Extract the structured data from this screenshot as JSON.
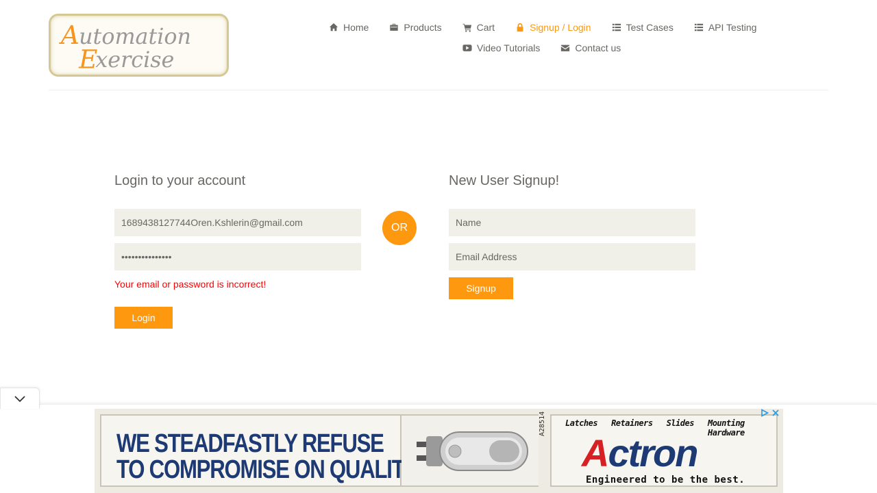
{
  "logo": {
    "line1": "Automation",
    "line2": "Exercise"
  },
  "nav": {
    "row1": [
      {
        "label": "Home",
        "icon": "home-icon"
      },
      {
        "label": "Products",
        "icon": "products-icon"
      },
      {
        "label": "Cart",
        "icon": "cart-icon"
      },
      {
        "label": "Signup / Login",
        "icon": "lock-icon",
        "active": true
      },
      {
        "label": "Test Cases",
        "icon": "list-icon"
      },
      {
        "label": "API Testing",
        "icon": "list-icon"
      }
    ],
    "row2": [
      {
        "label": "Video Tutorials",
        "icon": "youtube-play-icon"
      },
      {
        "label": "Contact us",
        "icon": "envelope-icon"
      }
    ]
  },
  "login": {
    "title": "Login to your account",
    "email_value": "1689438127744Oren.Kshlerin@gmail.com",
    "password_value": "•••••••••••••••",
    "error": "Your email or password is incorrect!",
    "button": "Login"
  },
  "or_label": "OR",
  "signup": {
    "title": "New User Signup!",
    "name_placeholder": "Name",
    "email_placeholder": "Email Address",
    "button": "Signup"
  },
  "ad": {
    "headline_line1": "WE STEADFASTLY REFUSE",
    "headline_line2": "TO COMPROMISE ON QUALITY.",
    "categories": [
      "Latches",
      "Retainers",
      "Slides",
      "Mounting Hardware"
    ],
    "brand_first": "A",
    "brand_rest": "ctron",
    "tagline": "Engineered to be the best.",
    "serial": "A28514"
  },
  "colors": {
    "accent": "#fe980f",
    "text": "#696763",
    "input_bg": "#f0f0e9",
    "error": "#ff0000"
  }
}
